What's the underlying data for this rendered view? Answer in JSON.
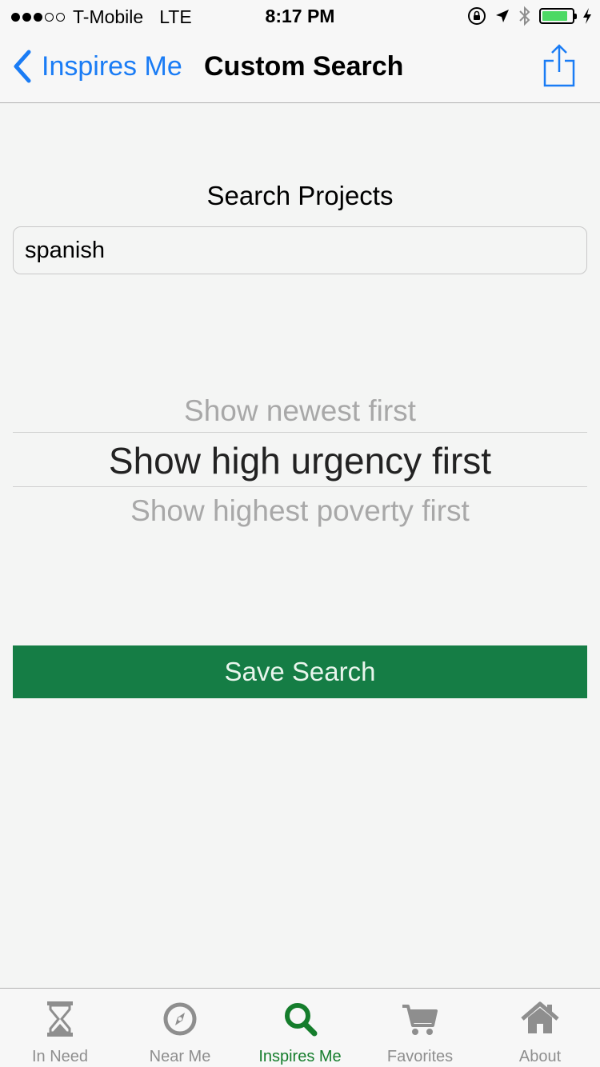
{
  "status_bar": {
    "carrier": "T-Mobile",
    "network": "LTE",
    "time": "8:17 PM",
    "signal_bars_filled": 3,
    "signal_bars_total": 5,
    "battery_level": 0.85,
    "icons": [
      "orientation-lock-icon",
      "location-arrow-icon",
      "bluetooth-icon",
      "battery-icon",
      "charging-bolt-icon"
    ]
  },
  "nav": {
    "back_label": "Inspires Me",
    "title": "Custom Search",
    "share_icon": "share-icon"
  },
  "search": {
    "heading": "Search Projects",
    "value": "spanish"
  },
  "picker": {
    "options": [
      "Show newest first",
      "Show high urgency first",
      "Show highest poverty first"
    ],
    "selected": "Show high urgency first"
  },
  "save_button": {
    "label": "Save Search"
  },
  "tabs": [
    {
      "label": "In Need",
      "icon": "hourglass-icon",
      "active": false
    },
    {
      "label": "Near Me",
      "icon": "compass-icon",
      "active": false
    },
    {
      "label": "Inspires Me",
      "icon": "search-icon",
      "active": true
    },
    {
      "label": "Favorites",
      "icon": "cart-icon",
      "active": false
    },
    {
      "label": "About",
      "icon": "home-icon",
      "active": false
    }
  ],
  "colors": {
    "accent_blue": "#1a7cf5",
    "button_green": "#157d45",
    "active_tab_green": "#157d2c",
    "background": "#f4f5f4"
  }
}
